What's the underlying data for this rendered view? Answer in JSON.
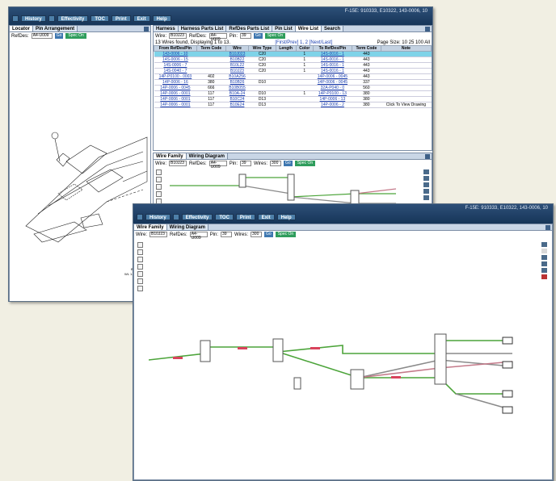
{
  "toolbar": {
    "info": "F-15E: 910333, E10322, 143-0006, 10",
    "info2": "F-15E: 910333, E10322, 143-0006, 10",
    "buttons": [
      "History",
      "Effectivity",
      "TOC",
      "Print",
      "Exit",
      "Help"
    ]
  },
  "locator": {
    "tabs": [
      "Locator",
      "Pin Arrangement"
    ],
    "refdes_label": "RefDes:",
    "refdes_value": "A4-U009",
    "go": "Go",
    "spec": "Spec On",
    "caption": "BS1091.0\nWL 1.0 / BL 0.00"
  },
  "wirelist": {
    "tabs": [
      "Harness",
      "Harness Parts List",
      "RefDes Parts List",
      "Pin List",
      "Wire List",
      "Search"
    ],
    "wire_label": "Wire:",
    "wire_value": "B10J23",
    "refdes_label": "RefDes:",
    "refdes_value": "A4-U009",
    "pin_label": "Pin:",
    "pin_value": "39",
    "go": "Go",
    "spec": "Spec On",
    "status": "13 Wires found, Displaying 1 to 13.",
    "pager": "[First/Prev] 1, 2 [Next/Last]",
    "pagesize": "Page Size: 10 25 100 All",
    "columns": [
      "From RefDes/Pin",
      "Term Code",
      "Wire",
      "Wire Type",
      "Length",
      "Color",
      "To RefDes/Pin",
      "Term Code",
      "Note"
    ],
    "rows": [
      [
        "143-0006 - 10",
        "",
        "B10J023",
        "C20",
        "",
        "1",
        "14S-0016 - 1",
        "443",
        ""
      ],
      [
        "14S-0006 - 15",
        "",
        "B10B22",
        "C20",
        "",
        "1",
        "14S-0016 - 1",
        "443",
        ""
      ],
      [
        "14S-0006 - 7",
        "",
        "B10L22",
        "C20",
        "",
        "1",
        "14S-0016 - 1",
        "443",
        ""
      ],
      [
        "14S-0040 - 7",
        "",
        "B10J23",
        "C20",
        "",
        "1",
        "14S-0016 - 1",
        "443",
        ""
      ],
      [
        "14P-P0100 - 0003",
        "402",
        "B10A256",
        "",
        "",
        "",
        "14P-0006 - 0045",
        "443",
        ""
      ],
      [
        "14P-0006 - 16",
        "380",
        "B10B26",
        "D10",
        "",
        "",
        "14P-0006 - 0045",
        "337",
        ""
      ],
      [
        "14P-0006 - 0045",
        "666",
        "B10B055",
        "",
        "",
        "",
        "32A-P040 - 0",
        "560",
        ""
      ],
      [
        "14P-0006 - 0001",
        "117",
        "B10A-24",
        "D10",
        "",
        "1",
        "14P-P0100 - 13",
        "380",
        ""
      ],
      [
        "14P-0006 - 0001",
        "117",
        "B10C24",
        "D13",
        "",
        "",
        "14P-0006 - 13",
        "380",
        ""
      ],
      [
        "14P-0006 - 0001",
        "117",
        "B10E24",
        "D13",
        "",
        "",
        "14P-0006 - 2",
        "380",
        "Click To View Drawing"
      ]
    ]
  },
  "family1": {
    "tabs": [
      "Wire Family",
      "Wiring Diagram"
    ],
    "wire_label": "Wire:",
    "wire_value": "B10J23",
    "refdes_label": "RefDes:",
    "refdes_value": "A4-U009",
    "pin_label": "Pin:",
    "pin_value": "39",
    "wires_label": "Wires:",
    "wires_value": "300",
    "go": "Go",
    "spec": "Spec On"
  },
  "family2": {
    "tabs": [
      "Wire Family",
      "Wiring Diagram"
    ],
    "wire_label": "Wire:",
    "wire_value": "B10J23",
    "refdes_label": "RefDes:",
    "refdes_value": "A4-U009",
    "pin_label": "Pin:",
    "pin_value": "39",
    "wires_label": "Wires:",
    "wires_value": "300",
    "go": "Go",
    "spec": "Spec On"
  },
  "icons": [
    "zoom-in-icon",
    "zoom-out-icon",
    "zoom-fit-icon",
    "select-icon",
    "print-icon",
    "back-icon",
    "forward-icon"
  ],
  "colors": {
    "titlebar": "#1f3f66",
    "wire_green": "#4ca43a",
    "wire_gray": "#8a8a8a",
    "wire_pink": "#c47a8a",
    "highlight": "#7fd3e8"
  }
}
